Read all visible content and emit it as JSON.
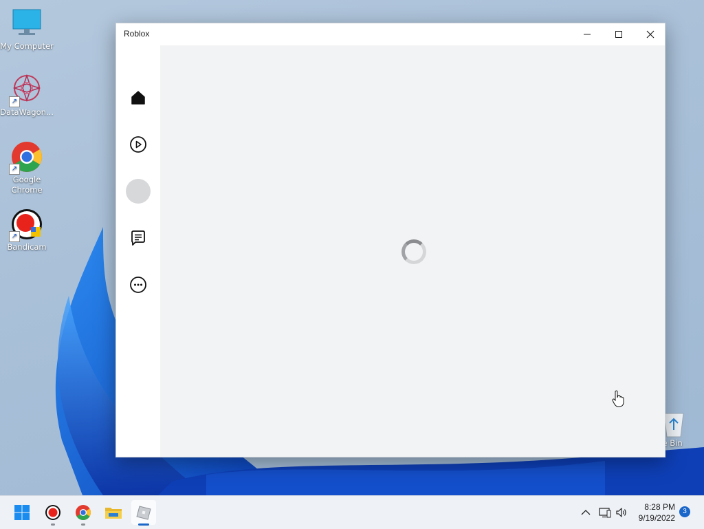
{
  "desktop": {
    "icons": [
      {
        "label": "My Computer"
      },
      {
        "label": "DataWagon..."
      },
      {
        "label": "Google Chrome"
      },
      {
        "label": "Bandicam"
      }
    ],
    "recycle_bin": {
      "label": "cle Bin"
    }
  },
  "window": {
    "title": "Roblox",
    "controls": {
      "minimize": "minimize-icon",
      "maximize": "maximize-icon",
      "close": "close-icon"
    },
    "nav": [
      {
        "name": "home",
        "icon": "home-icon"
      },
      {
        "name": "play",
        "icon": "play-circle-icon"
      },
      {
        "name": "avatar",
        "icon": "avatar-circle"
      },
      {
        "name": "chat",
        "icon": "chat-icon"
      },
      {
        "name": "more",
        "icon": "more-icon"
      }
    ],
    "loading": true
  },
  "taskbar": {
    "apps": [
      "start-icon",
      "bandicam-icon",
      "chrome-icon",
      "file-explorer-icon",
      "roblox-icon"
    ],
    "time": "8:28 PM",
    "date": "9/19/2022",
    "notification_count": "3"
  },
  "colors": {
    "accent": "#1a66c9",
    "window_bg": "#f2f3f4"
  }
}
